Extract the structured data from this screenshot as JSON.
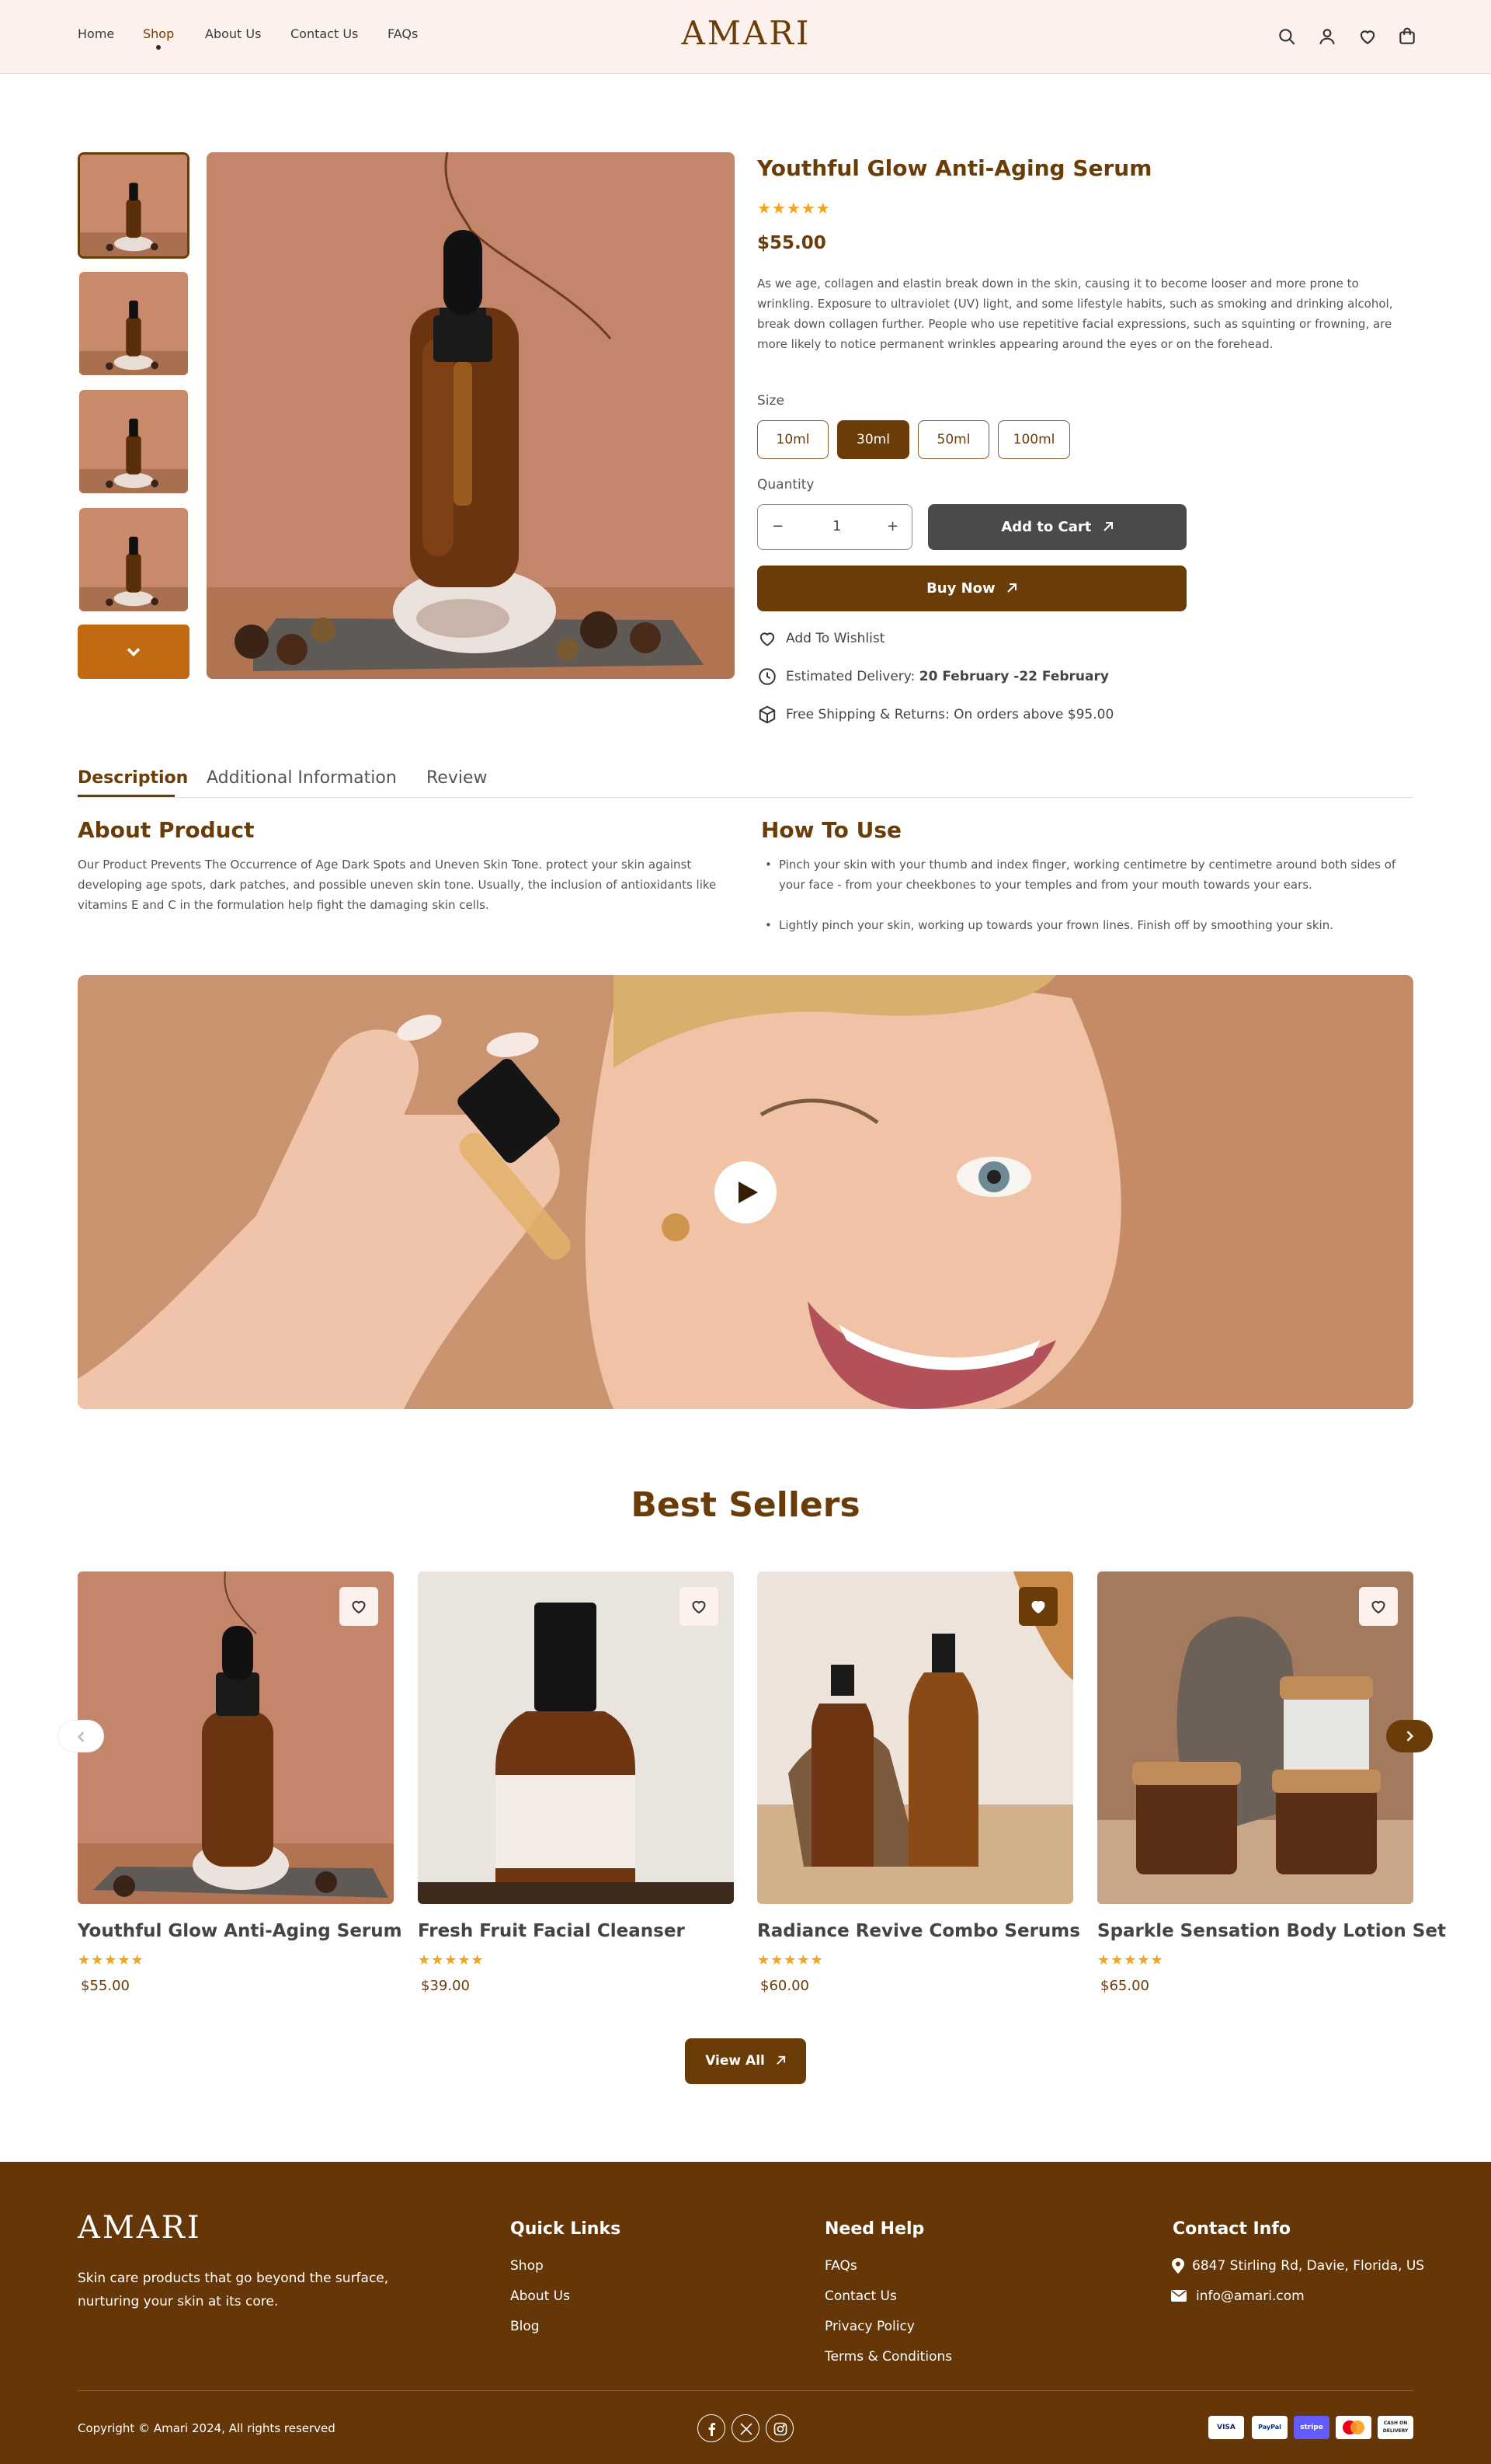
{
  "header": {
    "nav": [
      "Home",
      "Shop",
      "About Us",
      "Contact Us",
      "FAQs"
    ],
    "active_nav": "Shop",
    "logo": "AMARI",
    "icons": [
      "search-icon",
      "user-icon",
      "heart-icon",
      "cart-icon"
    ]
  },
  "product": {
    "title": "Youthful Glow Anti-Aging Serum",
    "rating": 5,
    "stars": "★★★★★",
    "price": "$55.00",
    "description": "As we age, collagen and elastin break down in the skin, causing it to become looser and more prone to wrinkling. Exposure to ultraviolet (UV) light, and some lifestyle habits, such as smoking and drinking alcohol, break down collagen further. People who use repetitive facial expressions, such as squinting or frowning, are more likely to notice permanent wrinkles appearing around the eyes or on the forehead.",
    "size_label": "Size",
    "sizes": [
      "10ml",
      "30ml",
      "50ml",
      "100ml"
    ],
    "selected_size": "30ml",
    "quantity_label": "Quantity",
    "quantity": "1",
    "qty_minus": "−",
    "qty_plus": "+",
    "add_to_cart": "Add to Cart",
    "buy_now": "Buy Now",
    "wishlist": "Add To Wishlist",
    "delivery_label": "Estimated Delivery:",
    "delivery_dates": "20 February -22 February",
    "shipping": "Free Shipping & Returns: On orders above $95.00"
  },
  "tabs": {
    "items": [
      "Description",
      "Additional Information",
      "Review"
    ],
    "active": "Description"
  },
  "about": {
    "heading": "About Product",
    "text": "Our Product Prevents The Occurrence of Age Dark Spots and Uneven Skin Tone. protect your skin against developing age spots, dark patches, and possible uneven skin tone. Usually, the inclusion of antioxidants like vitamins E and C in the formulation help fight the damaging skin cells."
  },
  "how_to_use": {
    "heading": "How To Use",
    "steps": [
      "Pinch your skin with your thumb and index finger, working centimetre by centimetre around both sides of your face - from your cheekbones to your temples and from your mouth towards your ears.",
      "Lightly pinch your skin, working up towards your frown lines. Finish off by smoothing your skin."
    ]
  },
  "best_sellers": {
    "heading": "Best Sellers",
    "products": [
      {
        "name": "Youthful Glow Anti-Aging Serum",
        "stars": "★★★★★",
        "price": "$55.00"
      },
      {
        "name": "Fresh Fruit Facial Cleanser",
        "stars": "★★★★★",
        "price": "$39.00"
      },
      {
        "name": "Radiance Revive Combo Serums",
        "stars": "★★★★★",
        "price": "$60.00"
      },
      {
        "name": "Sparkle Sensation Body Lotion Set",
        "stars": "★★★★★",
        "price": "$65.00"
      }
    ],
    "view_all": "View All"
  },
  "footer": {
    "logo": "AMARI",
    "tagline": "Skin care products that go beyond the surface, nurturing your skin at its core.",
    "quick_links_heading": "Quick Links",
    "quick_links": [
      "Shop",
      "About Us",
      "Blog"
    ],
    "need_help_heading": "Need Help",
    "need_help": [
      "FAQs",
      "Contact Us",
      "Privacy Policy",
      "Terms & Conditions"
    ],
    "contact_heading": "Contact Info",
    "address": "6847 Stirling Rd, Davie, Florida, US",
    "email": "info@amari.com",
    "copyright": "Copyright © Amari 2024, All rights reserved",
    "payments": [
      "VISA",
      "PayPal",
      "stripe",
      "",
      "CASH ON DELIVERY"
    ]
  },
  "colors": {
    "brand": "#6a3c08",
    "accent": "#c26a11",
    "star": "#f2a41a",
    "header_bg": "#fdf1ee",
    "footer_bg": "#653607"
  }
}
